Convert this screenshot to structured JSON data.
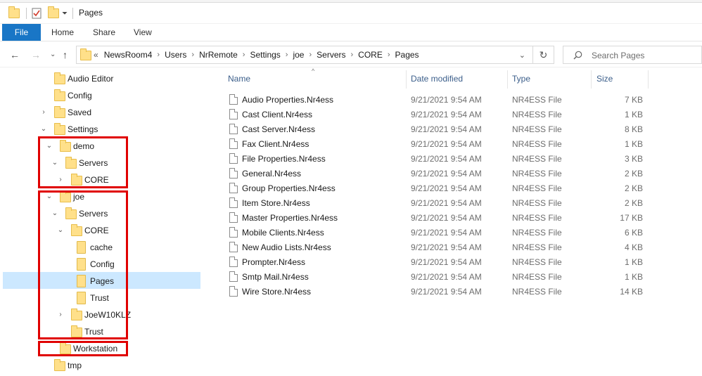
{
  "window": {
    "title": "Pages"
  },
  "ribbon": {
    "tabs": [
      "File",
      "Home",
      "Share",
      "View"
    ]
  },
  "address_bar": {
    "overflow": "«",
    "crumbs": [
      "NewsRoom4",
      "Users",
      "NrRemote",
      "Settings",
      "joe",
      "Servers",
      "CORE",
      "Pages"
    ]
  },
  "search": {
    "placeholder": "Search Pages"
  },
  "tree": [
    {
      "label": "Audio Editor",
      "chevron": ""
    },
    {
      "label": "Config",
      "chevron": ""
    },
    {
      "label": "Saved",
      "chevron": "›"
    },
    {
      "label": "Settings",
      "chevron": "⌄"
    },
    {
      "label": "demo",
      "chevron": "⌄"
    },
    {
      "label": "Servers",
      "chevron": "⌄"
    },
    {
      "label": "CORE",
      "chevron": "›"
    },
    {
      "label": "joe",
      "chevron": "⌄"
    },
    {
      "label": "Servers",
      "chevron": "⌄"
    },
    {
      "label": "CORE",
      "chevron": "⌄"
    },
    {
      "label": "cache",
      "chevron": ""
    },
    {
      "label": "Config",
      "chevron": ""
    },
    {
      "label": "Pages",
      "chevron": ""
    },
    {
      "label": "Trust",
      "chevron": ""
    },
    {
      "label": "JoeW10KLZ",
      "chevron": "›"
    },
    {
      "label": "Trust",
      "chevron": ""
    },
    {
      "label": "Workstation",
      "chevron": ""
    },
    {
      "label": "tmp",
      "chevron": ""
    }
  ],
  "columns": {
    "name": "Name",
    "date": "Date modified",
    "type": "Type",
    "size": "Size",
    "sort_indicator": "^"
  },
  "files": [
    {
      "name": "Audio Properties.Nr4ess",
      "date": "9/21/2021 9:54 AM",
      "type": "NR4ESS File",
      "size": "7 KB"
    },
    {
      "name": "Cast Client.Nr4ess",
      "date": "9/21/2021 9:54 AM",
      "type": "NR4ESS File",
      "size": "1 KB"
    },
    {
      "name": "Cast Server.Nr4ess",
      "date": "9/21/2021 9:54 AM",
      "type": "NR4ESS File",
      "size": "8 KB"
    },
    {
      "name": "Fax Client.Nr4ess",
      "date": "9/21/2021 9:54 AM",
      "type": "NR4ESS File",
      "size": "1 KB"
    },
    {
      "name": "File Properties.Nr4ess",
      "date": "9/21/2021 9:54 AM",
      "type": "NR4ESS File",
      "size": "3 KB"
    },
    {
      "name": "General.Nr4ess",
      "date": "9/21/2021 9:54 AM",
      "type": "NR4ESS File",
      "size": "2 KB"
    },
    {
      "name": "Group Properties.Nr4ess",
      "date": "9/21/2021 9:54 AM",
      "type": "NR4ESS File",
      "size": "2 KB"
    },
    {
      "name": "Item Store.Nr4ess",
      "date": "9/21/2021 9:54 AM",
      "type": "NR4ESS File",
      "size": "2 KB"
    },
    {
      "name": "Master Properties.Nr4ess",
      "date": "9/21/2021 9:54 AM",
      "type": "NR4ESS File",
      "size": "17 KB"
    },
    {
      "name": "Mobile Clients.Nr4ess",
      "date": "9/21/2021 9:54 AM",
      "type": "NR4ESS File",
      "size": "6 KB"
    },
    {
      "name": "New Audio Lists.Nr4ess",
      "date": "9/21/2021 9:54 AM",
      "type": "NR4ESS File",
      "size": "4 KB"
    },
    {
      "name": "Prompter.Nr4ess",
      "date": "9/21/2021 9:54 AM",
      "type": "NR4ESS File",
      "size": "1 KB"
    },
    {
      "name": "Smtp Mail.Nr4ess",
      "date": "9/21/2021 9:54 AM",
      "type": "NR4ESS File",
      "size": "1 KB"
    },
    {
      "name": "Wire Store.Nr4ess",
      "date": "9/21/2021 9:54 AM",
      "type": "NR4ESS File",
      "size": "14 KB"
    }
  ],
  "colors": {
    "file_tab": "#1976c6",
    "selection": "#cce8ff",
    "highlight_box": "#e00000",
    "folder": "#ffe08a"
  }
}
